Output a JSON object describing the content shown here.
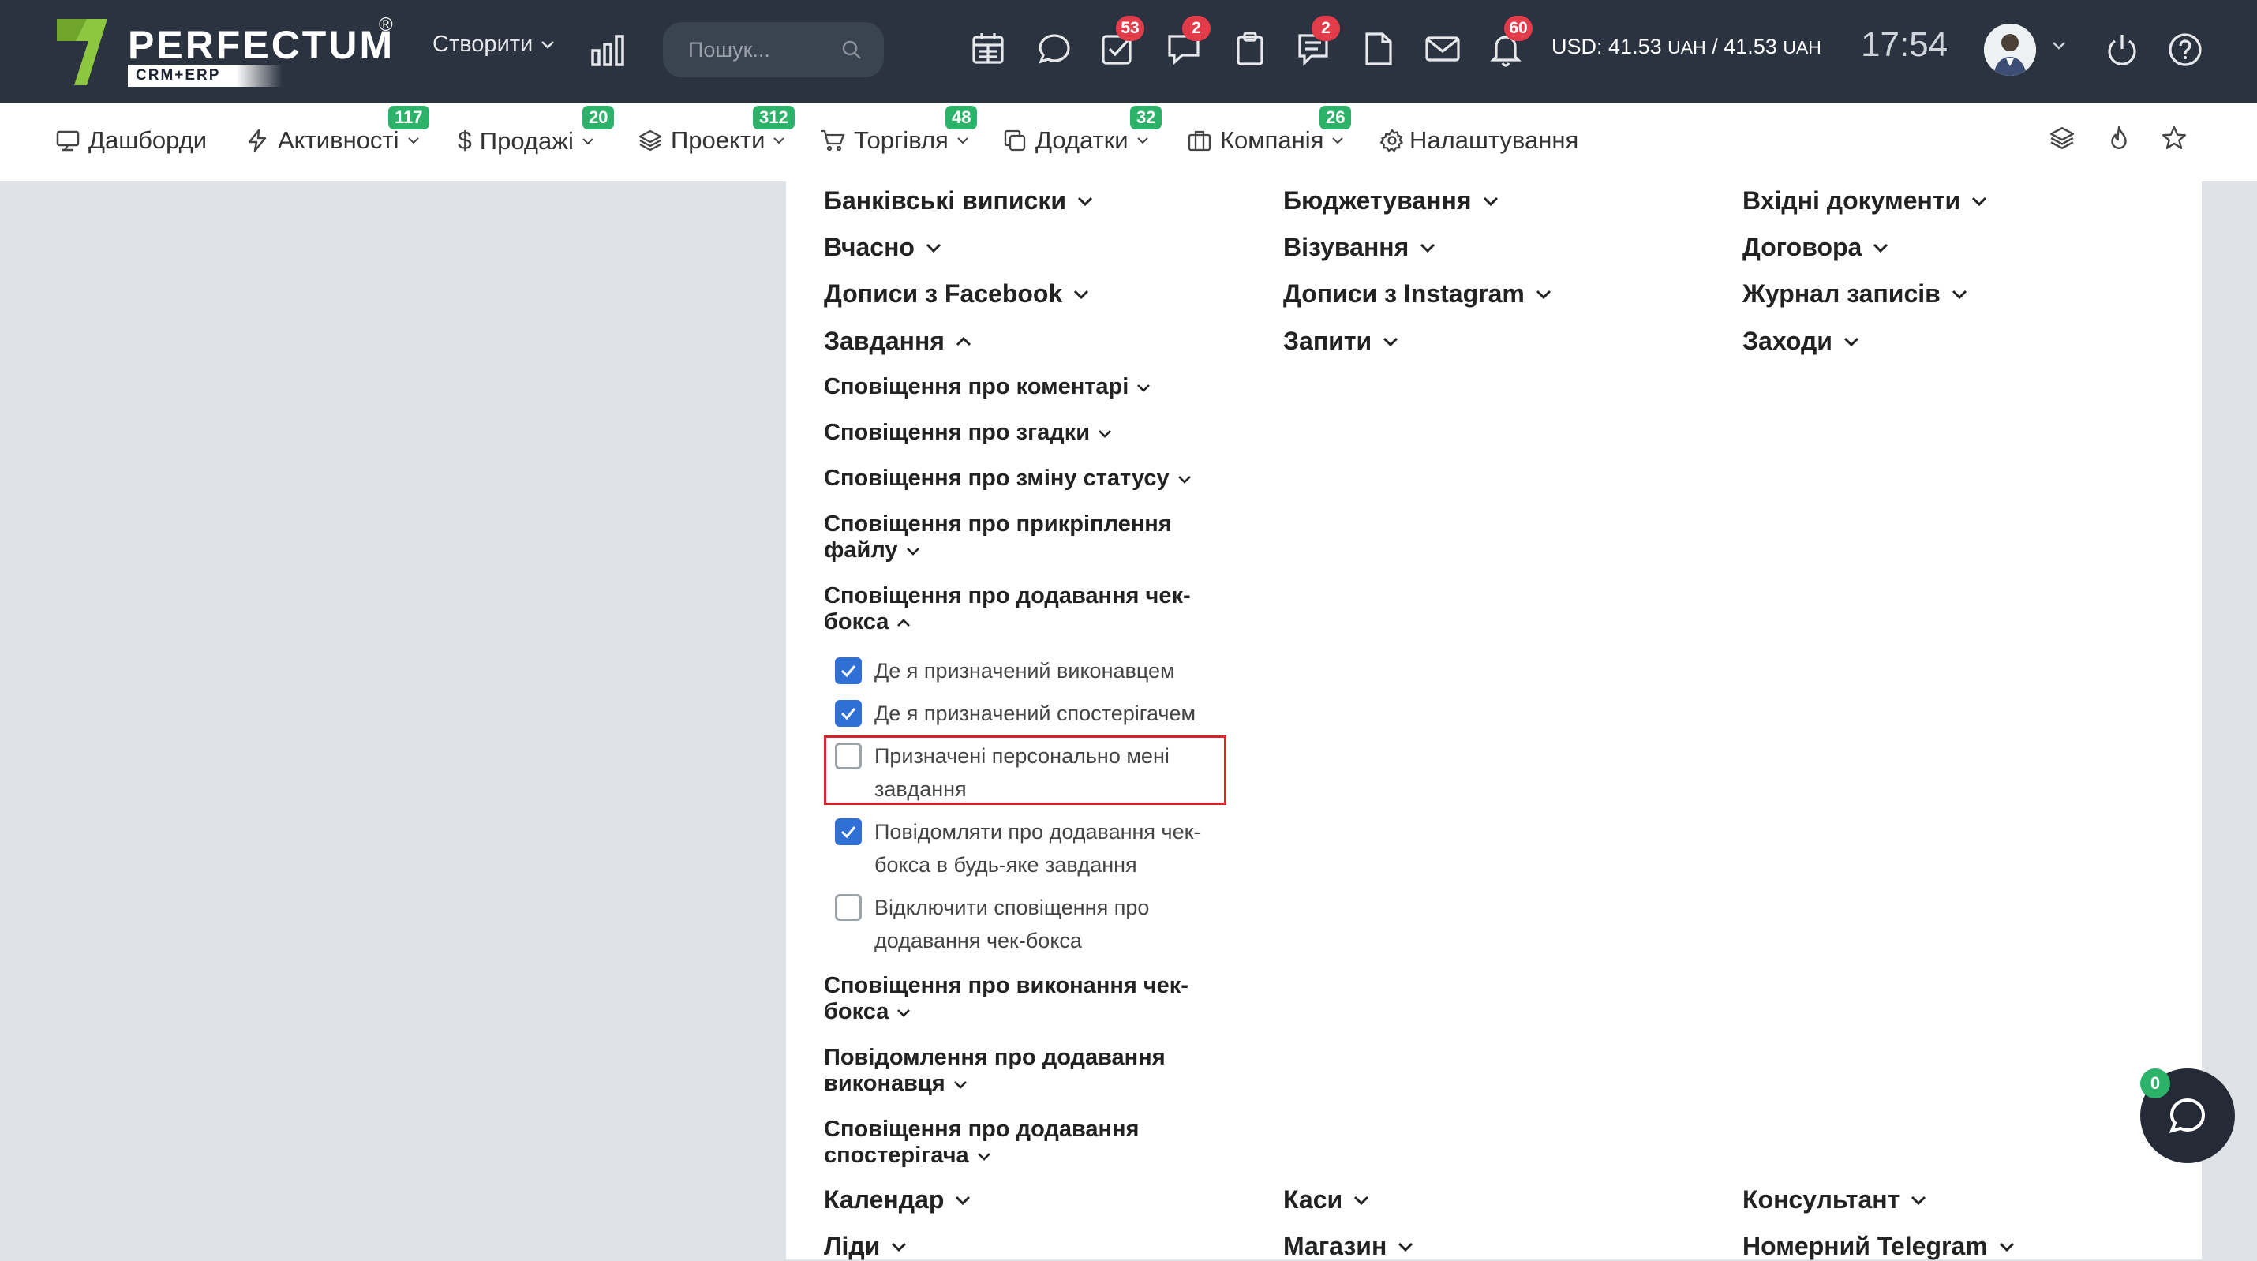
{
  "topbar": {
    "logo_text": "PERFECTUM",
    "logo_sub": "CRM+ERP",
    "logo_reg": "®",
    "create_label": "Створити",
    "search_placeholder": "Пошук...",
    "badges": {
      "tasks": "53",
      "chat": "2",
      "notes": "2",
      "notifications": "60"
    },
    "rates_usd_label": "USD:",
    "rate1": "41.53",
    "rate2": "41.53",
    "currency": "UAH",
    "rate_sep": "/",
    "time": "17:54"
  },
  "nav": {
    "items": [
      {
        "label": "Дашборди",
        "icon": "monitor-icon",
        "badge": ""
      },
      {
        "label": "Активності",
        "icon": "lightning-icon",
        "badge": "117"
      },
      {
        "label": "Продажі",
        "icon": "dollar-icon",
        "badge": "20"
      },
      {
        "label": "Проекти",
        "icon": "layers-icon",
        "badge": "312"
      },
      {
        "label": "Торгівля",
        "icon": "cart-icon",
        "badge": "48"
      },
      {
        "label": "Додатки",
        "icon": "copy-icon",
        "badge": "32"
      },
      {
        "label": "Компанія",
        "icon": "briefcase-icon",
        "badge": "26"
      },
      {
        "label": "Налаштування",
        "icon": "gear-icon",
        "badge": ""
      }
    ]
  },
  "sections": {
    "col1": [
      "Банківські виписки",
      "Вчасно",
      "Дописи з Facebook",
      "Завдання"
    ],
    "col2": [
      "Бюджетування",
      "Візування",
      "Дописи з Instagram",
      "Запити"
    ],
    "col3": [
      "Вхідні документи",
      "Договора",
      "Журнал записів",
      "Заходи"
    ],
    "bottom_row1": [
      "Календар",
      "Каси",
      "Консультант"
    ],
    "bottom_row2": [
      "Ліди",
      "Магазин",
      "Номерний Telegram"
    ]
  },
  "task_subsections": [
    "Сповіщення про коментарі",
    "Сповіщення про згадки",
    "Сповіщення про зміну статусу",
    "Сповіщення про прикріплення файлу",
    "Сповіщення про додавання чек-бокса",
    "Сповіщення про виконання чек-бокса",
    "Повідомлення про додавання виконавця",
    "Сповіщення про додавання спостерігача"
  ],
  "checkbox_options": [
    {
      "label": "Де я призначений виконавцем",
      "checked": true
    },
    {
      "label": "Де я призначений спостерігачем",
      "checked": true
    },
    {
      "label": "Призначені персонально мені завдання",
      "checked": false
    },
    {
      "label": "Повідомляти про додавання чек-бокса в будь-яке завдання",
      "checked": true
    },
    {
      "label": "Відключити сповіщення про додавання чек-бокса",
      "checked": false
    }
  ],
  "chat": {
    "badge": "0"
  },
  "colors": {
    "topbar_bg": "#2b3340",
    "badge_red": "#e23b4a",
    "badge_green": "#2db26a",
    "checkbox_blue": "#2f6fd6",
    "highlight_red": "#d8232a",
    "logo_green": "#8dc63f"
  }
}
